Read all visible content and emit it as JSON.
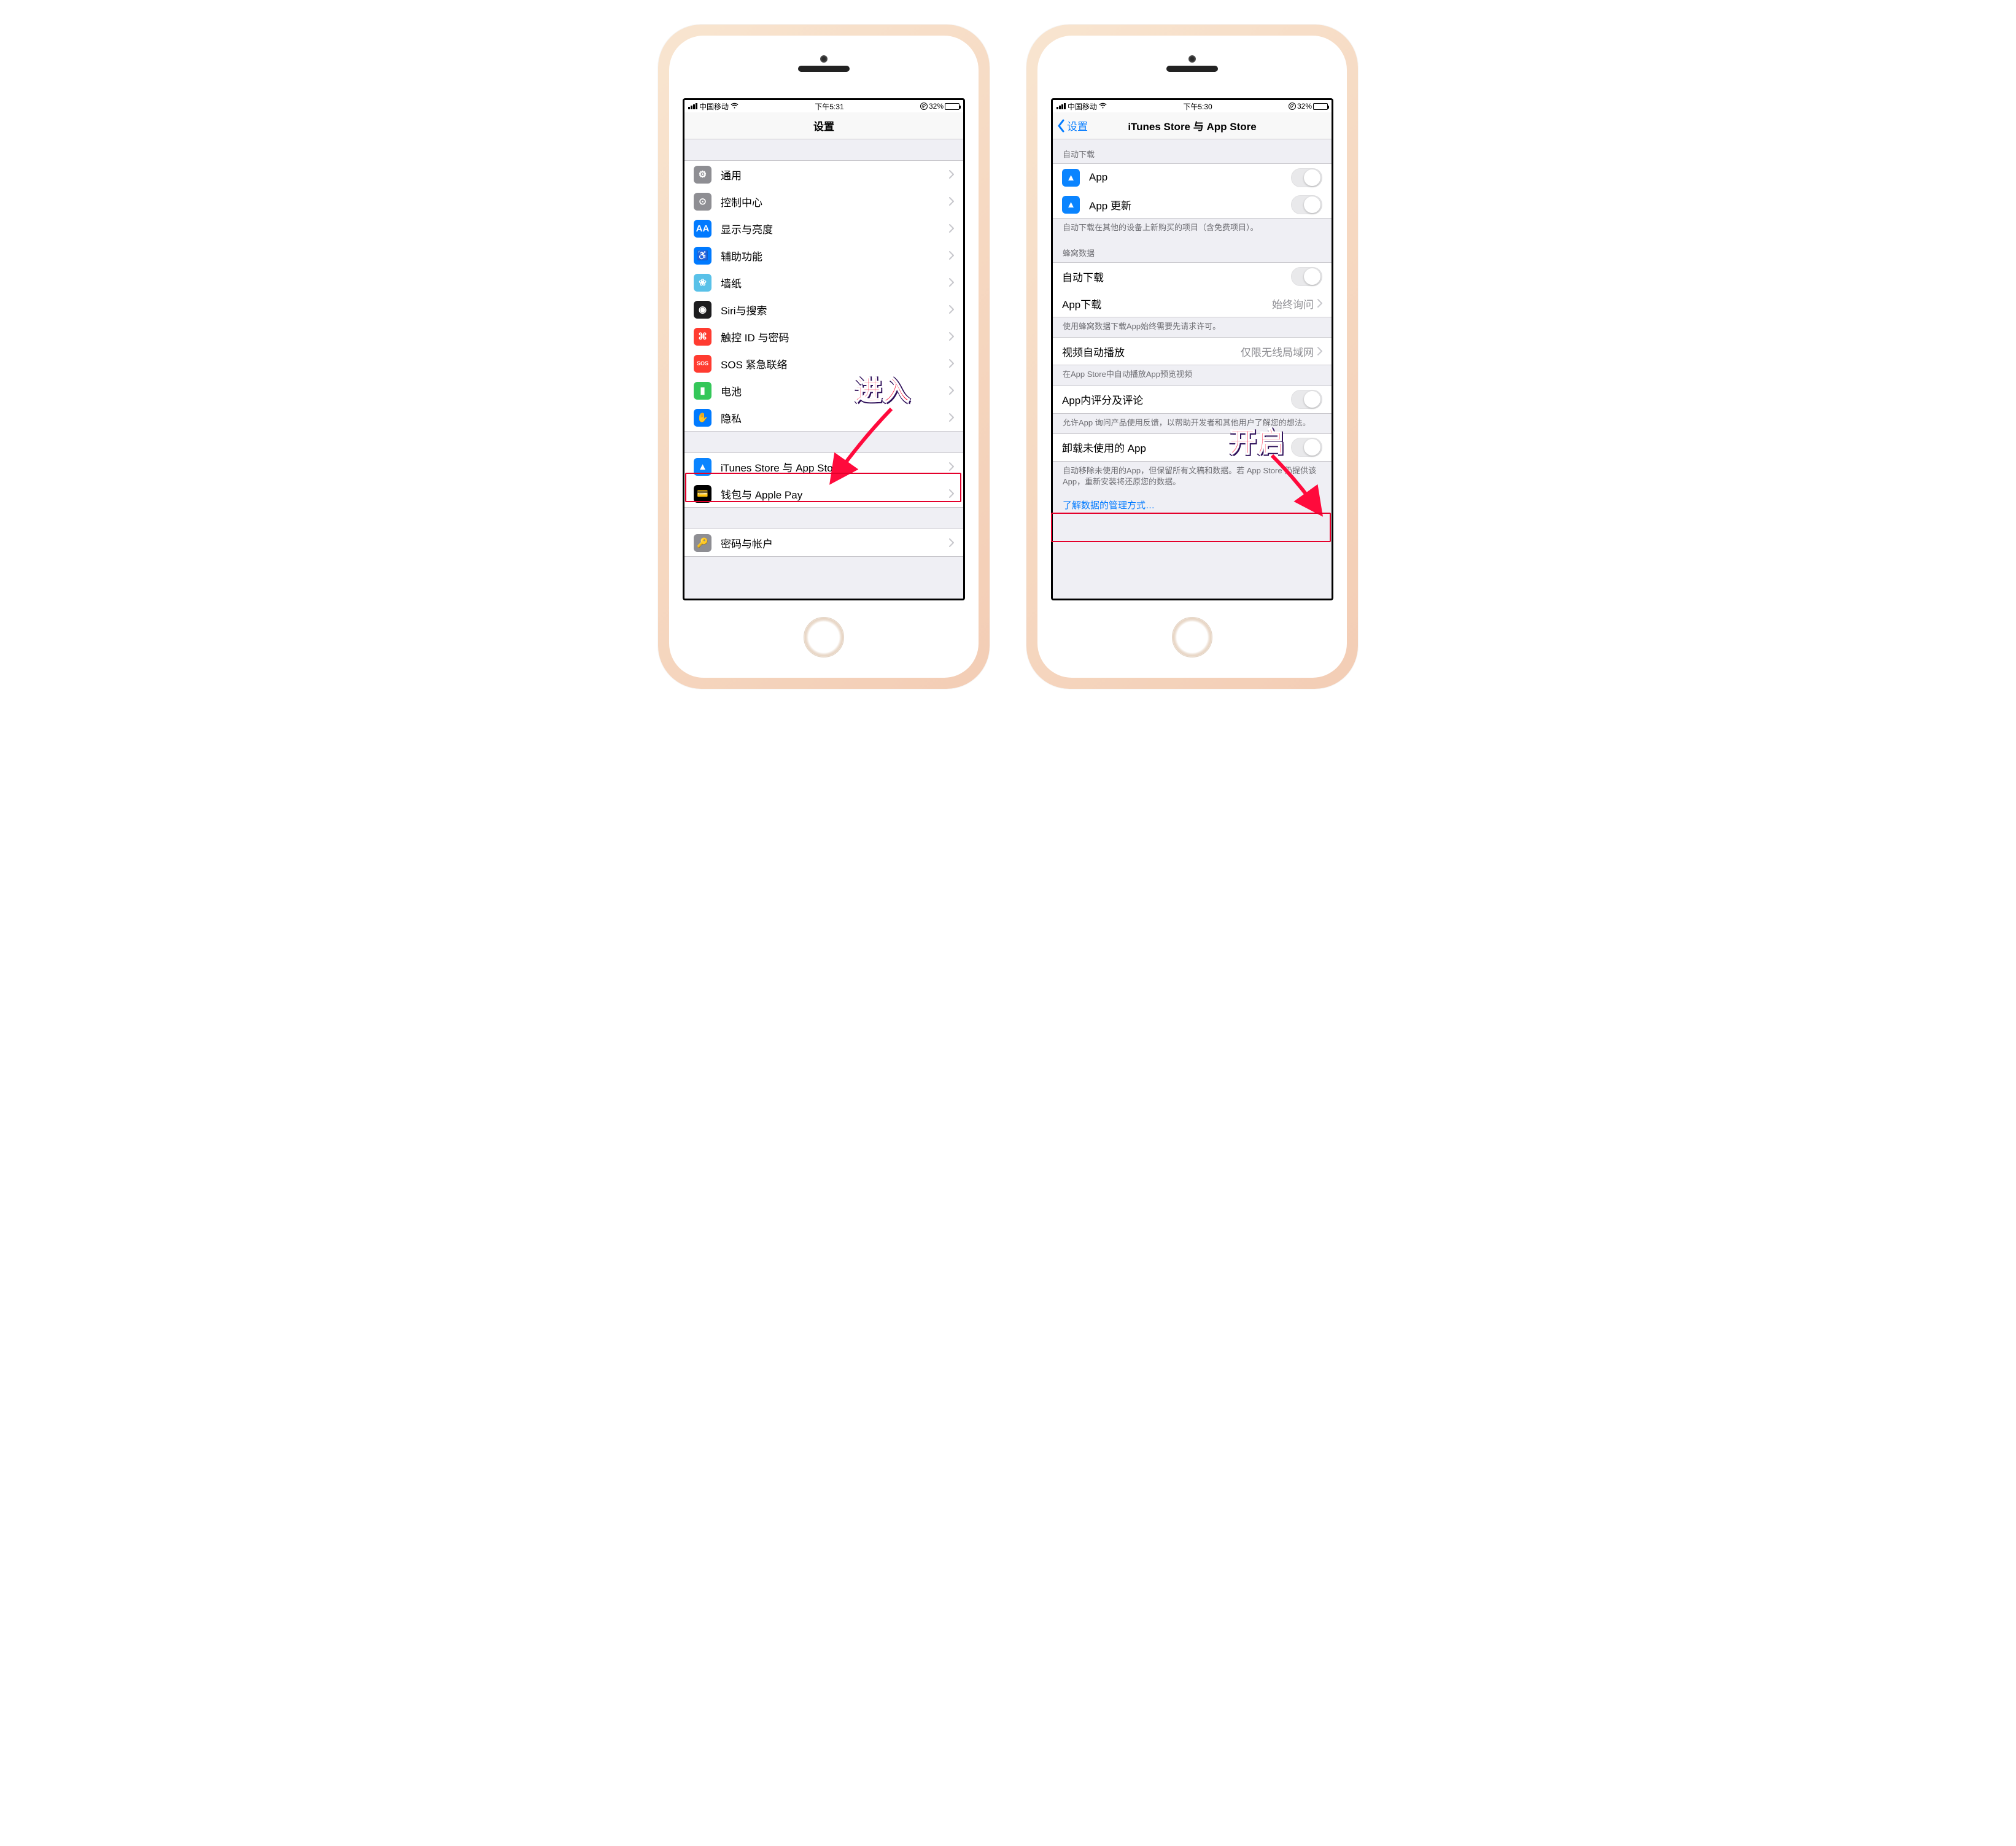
{
  "left": {
    "status": {
      "carrier": "中国移动",
      "time": "下午5:31",
      "battery_pct": "32%"
    },
    "title": "设置",
    "groups": [
      {
        "cells": [
          {
            "key": "general",
            "label": "通用",
            "iconClass": "ic-general",
            "glyph": "⚙"
          },
          {
            "key": "control_center",
            "label": "控制中心",
            "iconClass": "ic-control",
            "glyph": "⊙"
          },
          {
            "key": "display",
            "label": "显示与亮度",
            "iconClass": "ic-display",
            "glyph": "AA"
          },
          {
            "key": "accessibility",
            "label": "辅助功能",
            "iconClass": "ic-access",
            "glyph": "♿"
          },
          {
            "key": "wallpaper",
            "label": "墙纸",
            "iconClass": "ic-wallpaper",
            "glyph": "❀"
          },
          {
            "key": "siri",
            "label": "Siri与搜索",
            "iconClass": "ic-siri",
            "glyph": "◉"
          },
          {
            "key": "touchid",
            "label": "触控 ID 与密码",
            "iconClass": "ic-touchid",
            "glyph": "⌘"
          },
          {
            "key": "sos",
            "label": "SOS 紧急联络",
            "iconClass": "ic-sos",
            "glyph": "SOS"
          },
          {
            "key": "battery",
            "label": "电池",
            "iconClass": "ic-battery",
            "glyph": "▮"
          },
          {
            "key": "privacy",
            "label": "隐私",
            "iconClass": "ic-privacy",
            "glyph": "✋"
          }
        ]
      },
      {
        "cells": [
          {
            "key": "itunes_appstore",
            "label": "iTunes Store 与 App Store",
            "iconClass": "ic-appstore",
            "glyph": "▲"
          },
          {
            "key": "wallet",
            "label": "钱包与 Apple Pay",
            "iconClass": "ic-wallet",
            "glyph": "💳"
          }
        ]
      },
      {
        "cells": [
          {
            "key": "passwords",
            "label": "密码与帐户",
            "iconClass": "ic-passwords",
            "glyph": "🔑"
          }
        ]
      }
    ],
    "annotation": "进入"
  },
  "right": {
    "status": {
      "carrier": "中国移动",
      "time": "下午5:30",
      "battery_pct": "32%"
    },
    "back": "设置",
    "title": "iTunes Store 与 App Store",
    "sections": [
      {
        "header": "自动下载",
        "cells": [
          {
            "key": "app_auto",
            "label": "App",
            "type": "switch_icon",
            "iconClass": "ic-appstore",
            "glyph": "▲",
            "on": false
          },
          {
            "key": "app_update",
            "label": "App 更新",
            "type": "switch_icon",
            "iconClass": "ic-appstore",
            "glyph": "▲",
            "on": false
          }
        ],
        "footer": "自动下载在其他的设备上新购买的项目（含免费项目）。"
      },
      {
        "header": "蜂窝数据",
        "cells": [
          {
            "key": "cell_auto_dl",
            "label": "自动下载",
            "type": "switch",
            "on": false
          },
          {
            "key": "cell_app_dl",
            "label": "App下载",
            "type": "detail",
            "detail": "始终询问"
          }
        ],
        "footer": "使用蜂窝数据下载App始终需要先请求许可。"
      },
      {
        "cells": [
          {
            "key": "video_autoplay",
            "label": "视频自动播放",
            "type": "detail",
            "detail": "仅限无线局域网"
          }
        ],
        "footer": "在App Store中自动播放App预览视频"
      },
      {
        "cells": [
          {
            "key": "in_app_ratings",
            "label": "App内评分及评论",
            "type": "switch",
            "on": false
          }
        ],
        "footer": "允许App 询问产品使用反馈，以帮助开发者和其他用户了解您的想法。"
      },
      {
        "cells": [
          {
            "key": "offload_unused",
            "label": "卸载未使用的 App",
            "type": "switch",
            "on": false
          }
        ],
        "footer": "自动移除未使用的App，但保留所有文稿和数据。若 App Store 仍提供该App，重新安装将还原您的数据。"
      }
    ],
    "learn_more": "了解数据的管理方式…",
    "annotation": "开启"
  }
}
